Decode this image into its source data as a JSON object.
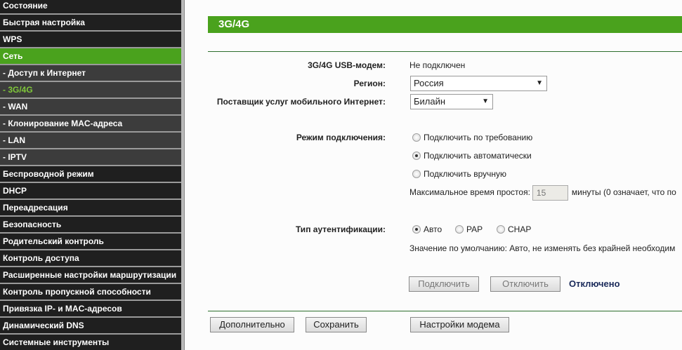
{
  "sidebar": {
    "items": [
      {
        "label": "Состояние"
      },
      {
        "label": "Быстрая настройка"
      },
      {
        "label": "WPS"
      },
      {
        "label": "Сеть"
      },
      {
        "label": "- Доступ к Интернет"
      },
      {
        "label": "- 3G/4G"
      },
      {
        "label": "- WAN"
      },
      {
        "label": "- Клонирование MAC-адреса"
      },
      {
        "label": "- LAN"
      },
      {
        "label": "- IPTV"
      },
      {
        "label": "Беспроводной режим"
      },
      {
        "label": "DHCP"
      },
      {
        "label": "Переадресация"
      },
      {
        "label": "Безопасность"
      },
      {
        "label": "Родительский контроль"
      },
      {
        "label": "Контроль доступа"
      },
      {
        "label": "Расширенные настройки маршрутизации"
      },
      {
        "label": "Контроль пропускной способности"
      },
      {
        "label": "Привязка IP- и MAC-адресов"
      },
      {
        "label": "Динамический DNS"
      },
      {
        "label": "Системные инструменты"
      }
    ]
  },
  "page": {
    "title": "3G/4G"
  },
  "form": {
    "modem_label": "3G/4G USB-модем:",
    "modem_value": "Не подключен",
    "region_label": "Регион:",
    "region_value": "Россия",
    "provider_label": "Поставщик услуг мобильного Интернет:",
    "provider_value": "Билайн",
    "mode_label": "Режим подключения:",
    "mode_options": [
      "Подключить по требованию",
      "Подключить автоматически",
      "Подключить вручную"
    ],
    "idle_label": "Максимальное время простоя:",
    "idle_value": "15",
    "idle_suffix": "минуты (0 означает, что по",
    "auth_label": "Тип аутентификации:",
    "auth_options": [
      "Авто",
      "PAP",
      "CHAP"
    ],
    "auth_note": "Значение по умолчанию: Авто, не изменять без крайней необходим",
    "connect_label": "Подключить",
    "disconnect_label": "Отключить",
    "status": "Отключено"
  },
  "footer": {
    "advanced_label": "Дополнительно",
    "save_label": "Сохранить",
    "modem_settings_label": "Настройки модема"
  },
  "colors": {
    "accent": "#4aa21d",
    "status": "#1a2a5a"
  }
}
